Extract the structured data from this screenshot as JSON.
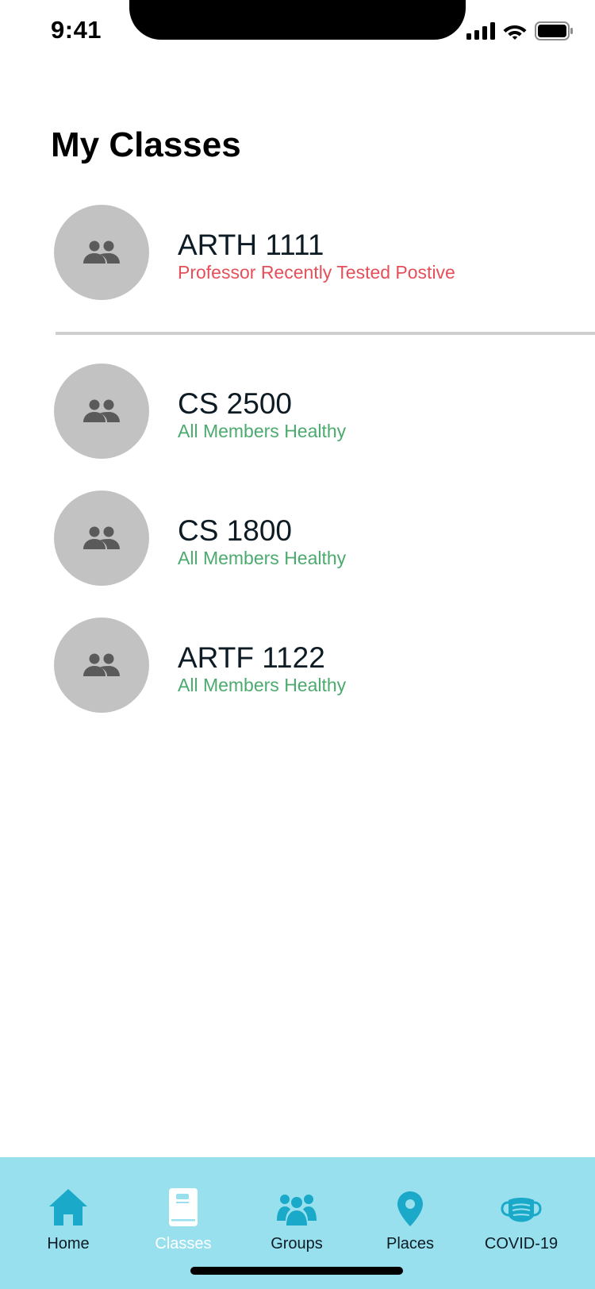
{
  "status_bar": {
    "time": "9:41",
    "icons": [
      "cellular-signal-icon",
      "wifi-icon",
      "battery-icon"
    ]
  },
  "page": {
    "title": "My Classes"
  },
  "classes": [
    {
      "name": "ARTH 1111",
      "status": "Professor Recently Tested Postive",
      "status_type": "alert",
      "icon": "group-icon"
    },
    {
      "name": "CS 2500",
      "status": "All Members Healthy",
      "status_type": "ok",
      "icon": "group-icon"
    },
    {
      "name": "CS 1800",
      "status": "All Members Healthy",
      "status_type": "ok",
      "icon": "group-icon"
    },
    {
      "name": "ARTF 1122",
      "status": "All Members Healthy",
      "status_type": "ok",
      "icon": "group-icon"
    }
  ],
  "tab_bar": {
    "active": "Classes",
    "tabs": [
      {
        "label": "Home",
        "icon": "home-icon"
      },
      {
        "label": "Classes",
        "icon": "book-icon"
      },
      {
        "label": "Groups",
        "icon": "people-icon"
      },
      {
        "label": "Places",
        "icon": "location-pin-icon"
      },
      {
        "label": "COVID-19",
        "icon": "face-mask-icon"
      }
    ]
  },
  "colors": {
    "alert": "#e4505a",
    "healthy": "#4caa6e",
    "tab_bar_bg": "#98e0ee",
    "tab_icon": "#1aa9c8",
    "avatar_bg": "#c2c2c2"
  }
}
